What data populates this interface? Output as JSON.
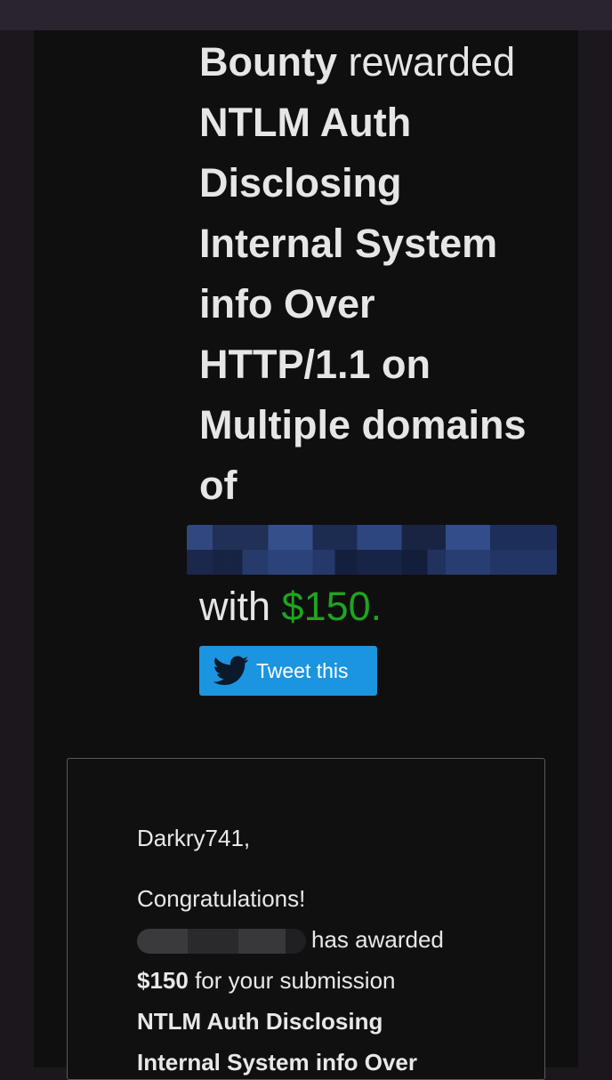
{
  "headline": {
    "bold_lead": "Bounty",
    "light_lead": "rewarded",
    "title_lines": [
      "NTLM Auth",
      "Disclosing",
      "Internal System",
      "info Over",
      "HTTP/1.1 on",
      "Multiple domains",
      "of"
    ],
    "with_text": "with",
    "amount": "$150."
  },
  "tweet_button": {
    "label": "Tweet this",
    "icon": "twitter-bird-icon"
  },
  "message_card": {
    "greeting": "Darkry741,",
    "congrats": "Congratulations!",
    "awarded_text": "has awarded",
    "amount": "$150",
    "submission_text": "for your submission",
    "title_line_1": "NTLM Auth Disclosing",
    "title_line_2": "Internal System info Over"
  },
  "colors": {
    "amount_green": "#1fa41f",
    "tweet_blue": "#1b95e0",
    "panel_bg": "#0f0f10"
  }
}
